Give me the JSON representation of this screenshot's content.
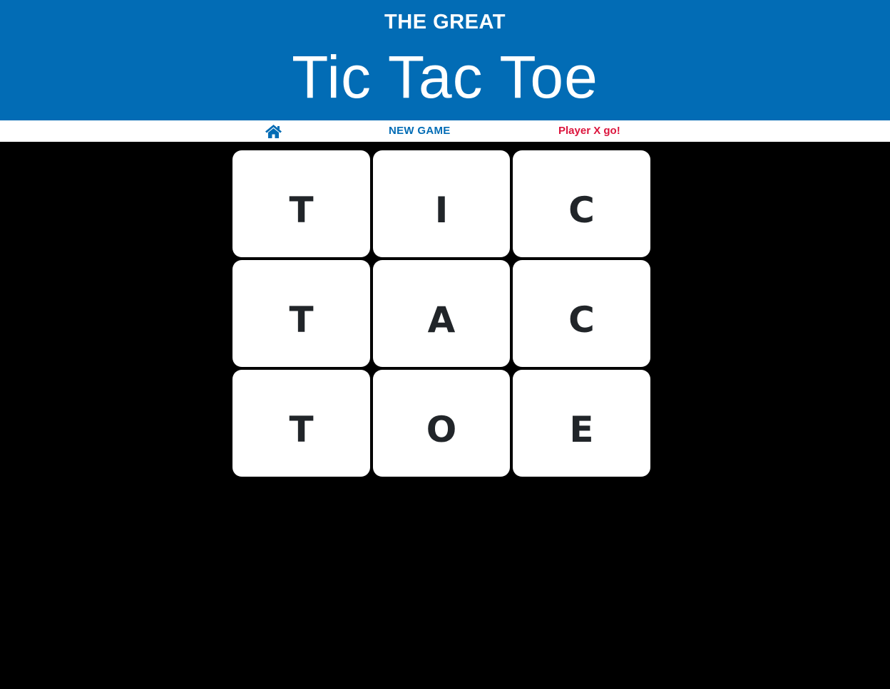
{
  "header": {
    "subtitle": "THE GREAT",
    "title": "Tic Tac Toe",
    "background_color": "#026cb5"
  },
  "nav": {
    "home_icon": "home-icon",
    "new_game_label": "NEW GAME",
    "status_text": "Player X go!",
    "accent_color": "#026cb5",
    "status_color": "#dc143c"
  },
  "board": {
    "cells": [
      "T",
      "I",
      "C",
      "T",
      "A",
      "C",
      "T",
      "O",
      "E"
    ]
  }
}
